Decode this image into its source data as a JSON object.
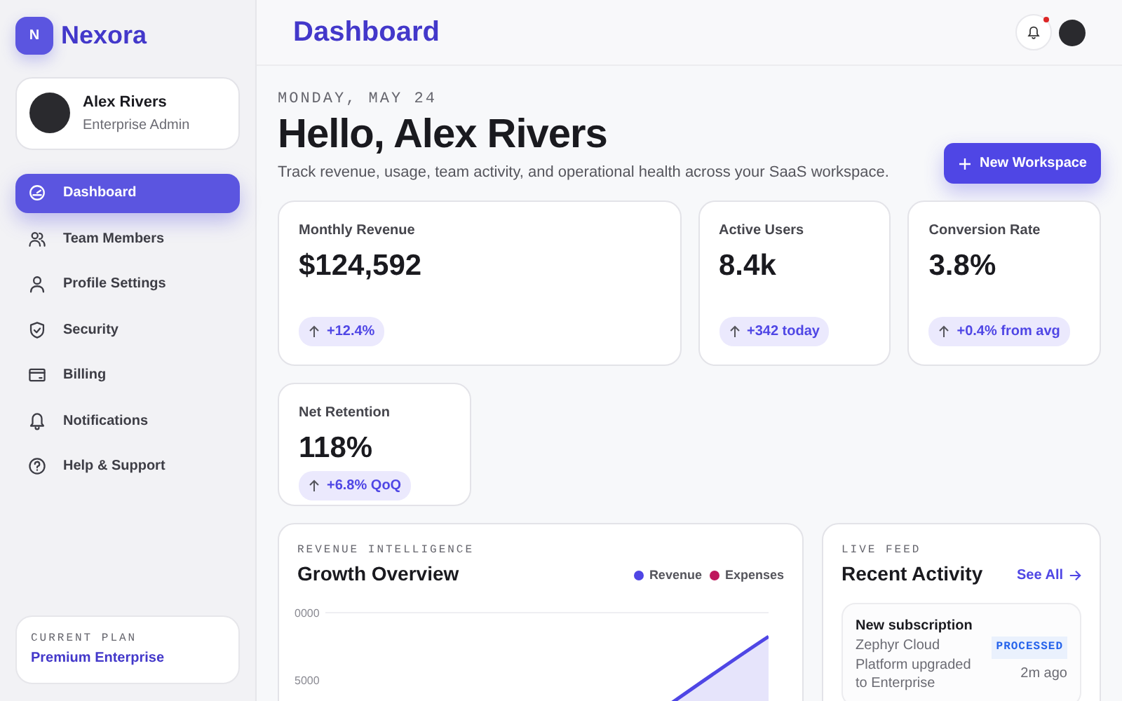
{
  "brand": {
    "logo_letter": "N",
    "name": "Nexora"
  },
  "user": {
    "name": "Alex Rivers",
    "role": "Enterprise Admin"
  },
  "sidebar": {
    "items": [
      {
        "label": "Dashboard",
        "selected": true
      },
      {
        "label": "Team Members",
        "selected": false
      },
      {
        "label": "Profile Settings",
        "selected": false
      },
      {
        "label": "Security",
        "selected": false
      },
      {
        "label": "Billing",
        "selected": false
      },
      {
        "label": "Notifications",
        "selected": false
      },
      {
        "label": "Help & Support",
        "selected": false
      }
    ]
  },
  "plan": {
    "label": "CURRENT PLAN",
    "name": "Premium Enterprise"
  },
  "header": {
    "title": "Dashboard",
    "has_unread": true
  },
  "greeting": {
    "date": "MONDAY, MAY 24",
    "title": "Hello, Alex Rivers",
    "subtitle": "Track revenue, usage, team activity, and operational health across your SaaS workspace.",
    "button": "New Workspace"
  },
  "stats": [
    {
      "label": "Monthly Revenue",
      "value": "$124,592",
      "change": "+12.4%",
      "wide": true
    },
    {
      "label": "Active Users",
      "value": "8.4k",
      "change": "+342 today",
      "wide": false
    },
    {
      "label": "Conversion Rate",
      "value": "3.8%",
      "change": "+0.4% from avg",
      "wide": false
    },
    {
      "label": "Net Retention",
      "value": "118%",
      "change": "+6.8% QoQ",
      "wide": false
    }
  ],
  "growth_overview": {
    "eyebrow": "REVENUE INTELLIGENCE",
    "title": "Growth Overview",
    "legend": [
      {
        "label": "Revenue",
        "color": "#4f46e5"
      },
      {
        "label": "Expenses",
        "color": "#be185d"
      }
    ],
    "axis_labels": [
      "0000",
      "5000"
    ]
  },
  "recent_activity": {
    "eyebrow": "LIVE FEED",
    "title": "Recent Activity",
    "link": "See All",
    "items": [
      {
        "title": "New subscription",
        "text": "Zephyr Cloud Platform upgraded to Enterprise",
        "status": "PROCESSED",
        "time": "2m ago"
      }
    ]
  }
}
